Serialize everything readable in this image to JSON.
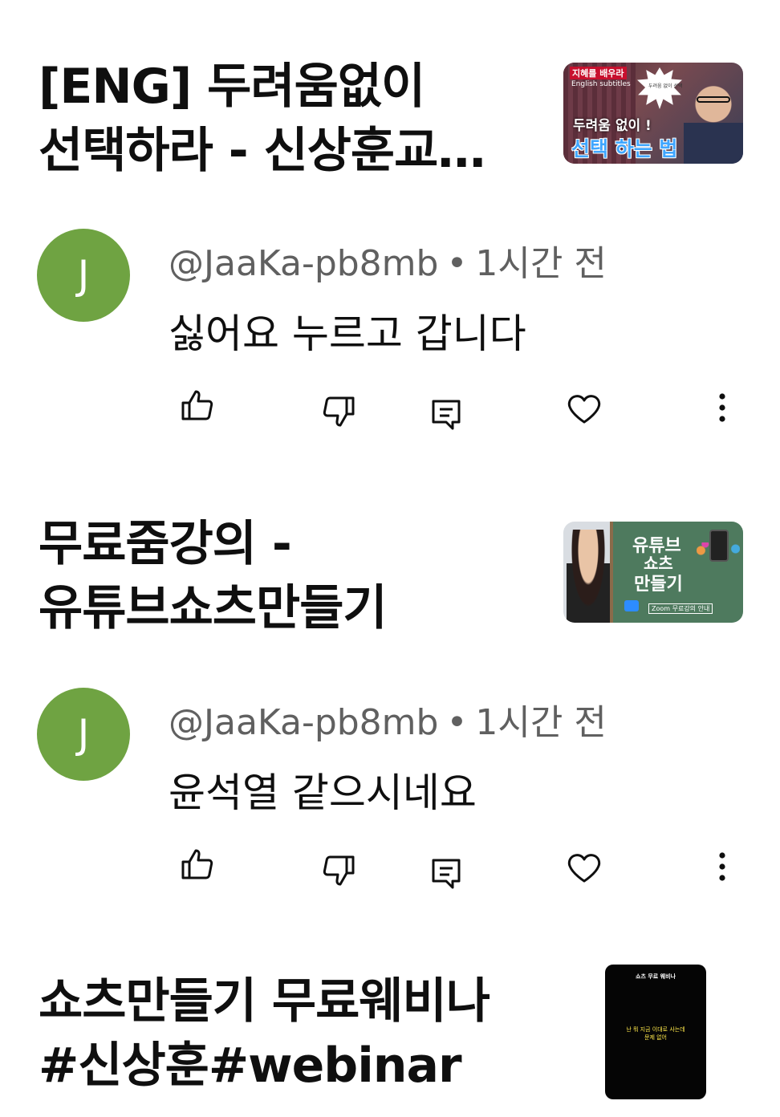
{
  "entries": [
    {
      "video_title_line1": "[ENG] 두려움없이",
      "video_title_line2": "선택하라 - 신상훈교…",
      "thumbnail": {
        "banner_text": "지혜를 배우라",
        "small_text": "English subtitles",
        "bubble_text": "두려움 없이 선택",
        "caption_top": "두려움 없이 !",
        "caption_main": "선택 하는 법"
      },
      "comment": {
        "avatar_letter": "J",
        "author": "@JaaKa-pb8mb",
        "separator": "•",
        "time": "1시간 전",
        "text": "싫어요 누르고 갑니다"
      }
    },
    {
      "video_title_line1": "무료줌강의 -",
      "video_title_line2": "유튜브쇼츠만들기",
      "thumbnail": {
        "board_line1": "유튜브",
        "board_line2": "쇼츠",
        "board_line3": "만들기",
        "bottom_caption": "Zoom 무료강의 안내"
      },
      "comment": {
        "avatar_letter": "J",
        "author": "@JaaKa-pb8mb",
        "separator": "•",
        "time": "1시간 전",
        "text": "윤석열 같으시네요"
      }
    },
    {
      "video_title_line1": "쇼츠만들기 무료웨비나",
      "video_title_line2": "#신상훈#webinar",
      "thumbnail": {
        "top_text": "쇼츠 무료 웨비나",
        "body_line1": "난 뭐 지금 이대로 사는데",
        "body_line2": "문제 없어"
      }
    }
  ],
  "colors": {
    "avatar_bg": "#6fa342",
    "meta_text": "#606060",
    "title_text": "#0f0f0f"
  },
  "icons": [
    "like-icon",
    "dislike-icon",
    "reply-icon",
    "heart-icon",
    "more-icon"
  ]
}
